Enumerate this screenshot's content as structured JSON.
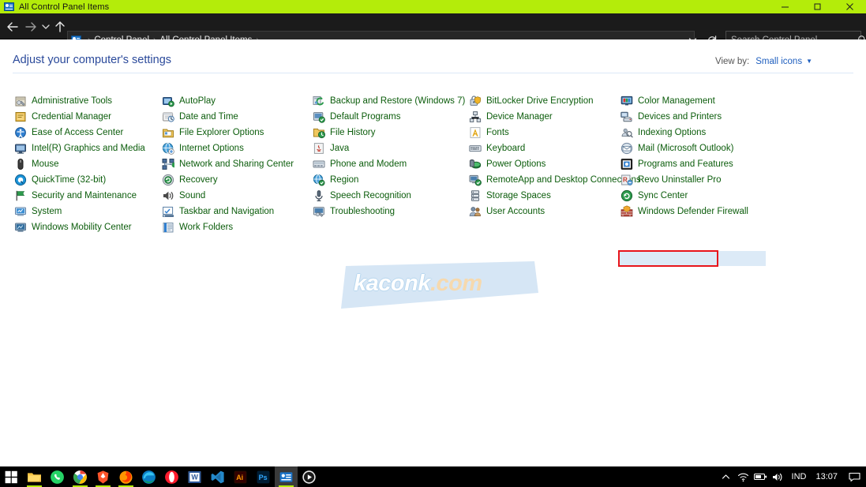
{
  "window": {
    "title": "All Control Panel Items",
    "titlebar_color": "#b4ec0a",
    "minimize_label": "Minimize",
    "maximize_label": "Maximize",
    "close_label": "Close"
  },
  "navbar": {
    "back_label": "Back",
    "forward_label": "Forward",
    "recent_label": "Recent locations",
    "up_label": "Up",
    "history_label": "Previous locations",
    "refresh_label": "Refresh",
    "breadcrumb": [
      "Control Panel",
      "All Control Panel Items"
    ],
    "separator": "›",
    "search_placeholder": "Search Control Panel",
    "search_value": ""
  },
  "content": {
    "heading": "Adjust your computer's settings",
    "view_by_label": "View by:",
    "view_by_value": "Small icons",
    "view_by_caret": "▼",
    "heading_color": "#2b4a9b",
    "link_color": "#0b5c0b"
  },
  "items": {
    "selected": "Programs and Features",
    "highlight_color": "#e8151b",
    "selection_color": "#dceaf7",
    "columns": [
      {
        "name": "column-1",
        "entries": [
          {
            "label": "Administrative Tools",
            "icon": "administrative-tools-icon"
          },
          {
            "label": "Credential Manager",
            "icon": "credential-manager-icon"
          },
          {
            "label": "Ease of Access Center",
            "icon": "ease-of-access-icon"
          },
          {
            "label": "Intel(R) Graphics and Media",
            "icon": "intel-graphics-icon"
          },
          {
            "label": "Mouse",
            "icon": "mouse-icon"
          },
          {
            "label": "QuickTime (32-bit)",
            "icon": "quicktime-icon"
          },
          {
            "label": "Security and Maintenance",
            "icon": "security-flag-icon"
          },
          {
            "label": "System",
            "icon": "system-icon"
          },
          {
            "label": "Windows Mobility Center",
            "icon": "mobility-center-icon"
          }
        ]
      },
      {
        "name": "column-2",
        "entries": [
          {
            "label": "AutoPlay",
            "icon": "autoplay-icon"
          },
          {
            "label": "Date and Time",
            "icon": "date-and-time-icon"
          },
          {
            "label": "File Explorer Options",
            "icon": "file-explorer-options-icon"
          },
          {
            "label": "Internet Options",
            "icon": "internet-options-icon"
          },
          {
            "label": "Network and Sharing Center",
            "icon": "network-sharing-icon"
          },
          {
            "label": "Recovery",
            "icon": "recovery-icon"
          },
          {
            "label": "Sound",
            "icon": "sound-icon"
          },
          {
            "label": "Taskbar and Navigation",
            "icon": "taskbar-navigation-icon"
          },
          {
            "label": "Work Folders",
            "icon": "work-folders-icon"
          }
        ]
      },
      {
        "name": "column-3",
        "entries": [
          {
            "label": "Backup and Restore (Windows 7)",
            "icon": "backup-restore-icon"
          },
          {
            "label": "Default Programs",
            "icon": "default-programs-icon"
          },
          {
            "label": "File History",
            "icon": "file-history-icon"
          },
          {
            "label": "Java",
            "icon": "java-icon"
          },
          {
            "label": "Phone and Modem",
            "icon": "phone-modem-icon"
          },
          {
            "label": "Region",
            "icon": "region-icon"
          },
          {
            "label": "Speech Recognition",
            "icon": "speech-recognition-icon"
          },
          {
            "label": "Troubleshooting",
            "icon": "troubleshooting-icon"
          }
        ]
      },
      {
        "name": "column-4",
        "entries": [
          {
            "label": "BitLocker Drive Encryption",
            "icon": "bitlocker-icon"
          },
          {
            "label": "Device Manager",
            "icon": "device-manager-icon"
          },
          {
            "label": "Fonts",
            "icon": "fonts-icon"
          },
          {
            "label": "Keyboard",
            "icon": "keyboard-icon"
          },
          {
            "label": "Power Options",
            "icon": "power-options-icon"
          },
          {
            "label": "RemoteApp and Desktop Connections",
            "icon": "remoteapp-icon"
          },
          {
            "label": "Storage Spaces",
            "icon": "storage-spaces-icon"
          },
          {
            "label": "User Accounts",
            "icon": "user-accounts-icon"
          }
        ]
      },
      {
        "name": "column-5",
        "entries": [
          {
            "label": "Color Management",
            "icon": "color-management-icon"
          },
          {
            "label": "Devices and Printers",
            "icon": "devices-printers-icon"
          },
          {
            "label": "Indexing Options",
            "icon": "indexing-options-icon"
          },
          {
            "label": "Mail (Microsoft Outlook)",
            "icon": "mail-outlook-icon"
          },
          {
            "label": "Programs and Features",
            "icon": "programs-features-icon"
          },
          {
            "label": "Revo Uninstaller Pro",
            "icon": "revo-uninstaller-icon"
          },
          {
            "label": "Sync Center",
            "icon": "sync-center-icon"
          },
          {
            "label": "Windows Defender Firewall",
            "icon": "windows-defender-firewall-icon"
          }
        ]
      }
    ]
  },
  "watermark": {
    "name": "kaconk",
    "tld": ".com"
  },
  "taskbar": {
    "apps": [
      {
        "name": "start-button",
        "label": "Start"
      },
      {
        "name": "file-explorer",
        "label": "File Explorer"
      },
      {
        "name": "whatsapp",
        "label": "WhatsApp"
      },
      {
        "name": "google-chrome",
        "label": "Google Chrome"
      },
      {
        "name": "brave-browser",
        "label": "Brave"
      },
      {
        "name": "mozilla-firefox",
        "label": "Firefox"
      },
      {
        "name": "microsoft-edge",
        "label": "Microsoft Edge"
      },
      {
        "name": "opera-browser",
        "label": "Opera"
      },
      {
        "name": "microsoft-word",
        "label": "Microsoft Word"
      },
      {
        "name": "visual-studio-code",
        "label": "Visual Studio Code"
      },
      {
        "name": "adobe-illustrator",
        "label": "Ai"
      },
      {
        "name": "adobe-photoshop",
        "label": "Ps"
      },
      {
        "name": "control-panel",
        "label": "Control Panel"
      },
      {
        "name": "media-player",
        "label": "Media Player"
      }
    ],
    "tray": {
      "chevron_label": "Show hidden icons",
      "wifi_label": "Network",
      "battery_label": "Battery",
      "volume_label": "Volume",
      "language": "IND",
      "time": "13:07",
      "notifications_label": "Notifications"
    }
  }
}
